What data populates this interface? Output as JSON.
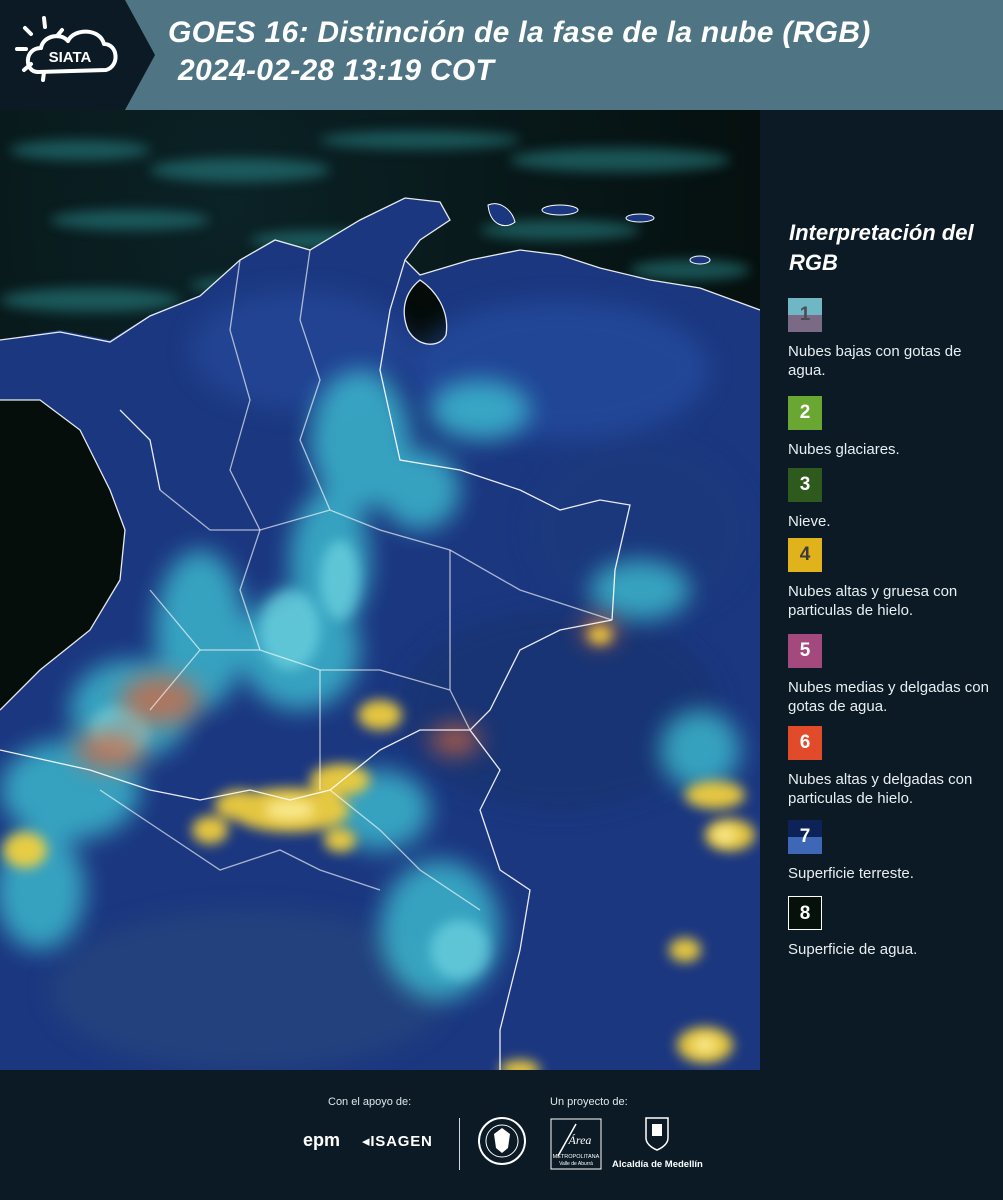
{
  "header": {
    "logo_text": "SIATA",
    "title": "GOES 16: Distinción de la fase de la nube (RGB)",
    "subtitle": "2024-02-28 13:19 COT"
  },
  "legend": {
    "title": "Interpretación del RGB",
    "items": [
      {
        "number": "1",
        "label": "Nubes bajas con gotas de agua.",
        "colors": [
          "#6fb7c4",
          "#7a6a86"
        ],
        "text_color": "#4a4a55"
      },
      {
        "number": "2",
        "label": "Nubes glaciares.",
        "colors": [
          "#6aa632"
        ],
        "text_color": "#ffffff"
      },
      {
        "number": "3",
        "label": "Nieve.",
        "colors": [
          "#2e5a1e"
        ],
        "text_color": "#ffffff"
      },
      {
        "number": "4",
        "label": "Nubes altas y gruesa con particulas de hielo.",
        "colors": [
          "#e0b21c"
        ],
        "text_color": "#3a3a3a"
      },
      {
        "number": "5",
        "label": "Nubes medias y delgadas con gotas de agua.",
        "colors": [
          "#a4497e"
        ],
        "text_color": "#ffffff"
      },
      {
        "number": "6",
        "label": "Nubes altas y delgadas con particulas de hielo.",
        "colors": [
          "#e14b2a"
        ],
        "text_color": "#ffffff"
      },
      {
        "number": "7",
        "label": "Superficie terreste.",
        "colors": [
          "#0d2257",
          "#3e67b8"
        ],
        "text_color": "#ffffff"
      },
      {
        "number": "8",
        "label": "Superficie de agua.",
        "colors": [
          "#05110a"
        ],
        "text_color": "#ffffff",
        "border": "#ffffff"
      }
    ]
  },
  "footer": {
    "support_label": "Con el apoyo de:",
    "project_label": "Un proyecto de:",
    "sponsors": [
      "epm",
      "ISAGEN"
    ],
    "partners": {
      "amva_name": "Área",
      "amva_line1": "METROPOLITANA",
      "amva_line2": "Valle de Aburrá",
      "medellin": "Alcaldía de Medellín"
    }
  },
  "colors": {
    "header_bg": "#4f7585",
    "page_bg": "#0b1a24",
    "ocean": "#050f0c",
    "land": "#1c3a86",
    "low_cloud": "#3fc6d6",
    "high_cloud": "#f6d23a",
    "thin_ice_cloud": "#e0784a"
  }
}
